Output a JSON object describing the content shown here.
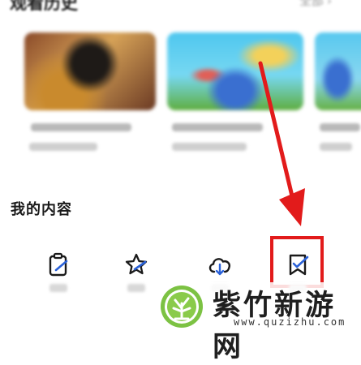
{
  "history": {
    "title": "观看历史",
    "see_more": "全部"
  },
  "my_content": {
    "title": "我的内容",
    "tools": [
      {
        "label": "订阅",
        "icon": "clipboard-edit-icon"
      },
      {
        "label": "收藏",
        "icon": "star-edit-icon"
      },
      {
        "label": "离线",
        "icon": "cloud-download-icon"
      },
      {
        "label": "待看",
        "icon": "bookmark-check-icon"
      }
    ]
  },
  "annotation": {
    "highlight_color": "#e21b1b",
    "arrow_color": "#e21b1b"
  },
  "watermark": {
    "name": "紫竹新游网",
    "url": "www.quzizhu.com",
    "logo_color": "#7cc243"
  }
}
